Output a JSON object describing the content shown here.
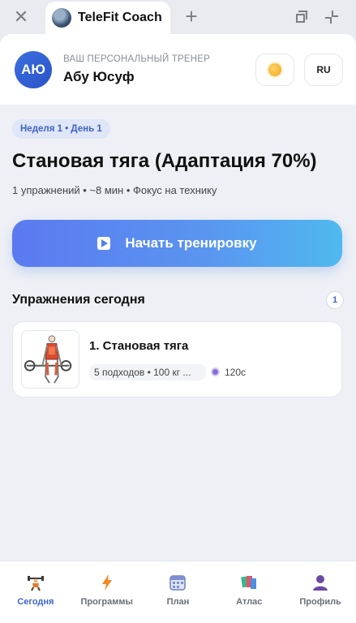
{
  "browser": {
    "tab_title": "TeleFit Coach",
    "close_icon": "close-icon",
    "new_tab_icon": "plus-icon"
  },
  "header": {
    "avatar_initials": "АЮ",
    "caption": "ВАШ ПЕРСОНАЛЬНЫЙ ТРЕНЕР",
    "name": "Абу Юсуф",
    "theme_icon": "sun-icon",
    "language": "RU"
  },
  "workout": {
    "badge": "Неделя 1 • День 1",
    "title": "Становая тяга (Адаптация 70%)",
    "meta": "1 упражнений • ~8 мин • Фокус на технику",
    "start_button": "Начать тренировку"
  },
  "exercises": {
    "section_title": "Упражнения сегодня",
    "count": "1",
    "items": [
      {
        "name": "1. Становая тяга",
        "details": "5 подходов • 100 кг ...",
        "rest": "120с",
        "thumbnail_icon": "deadlift-illustration"
      }
    ]
  },
  "nav": {
    "items": [
      {
        "label": "Сегодня",
        "icon": "weightlifter-icon",
        "active": true
      },
      {
        "label": "Программы",
        "icon": "lightning-icon",
        "active": false
      },
      {
        "label": "План",
        "icon": "calendar-icon",
        "active": false
      },
      {
        "label": "Атлас",
        "icon": "atlas-icon",
        "active": false
      },
      {
        "label": "Профиль",
        "icon": "profile-icon",
        "active": false
      }
    ]
  },
  "colors": {
    "accent": "#3d63c7",
    "cta_start": "#5b79f0",
    "cta_end": "#4fb9ef",
    "background": "#eef0f5"
  }
}
